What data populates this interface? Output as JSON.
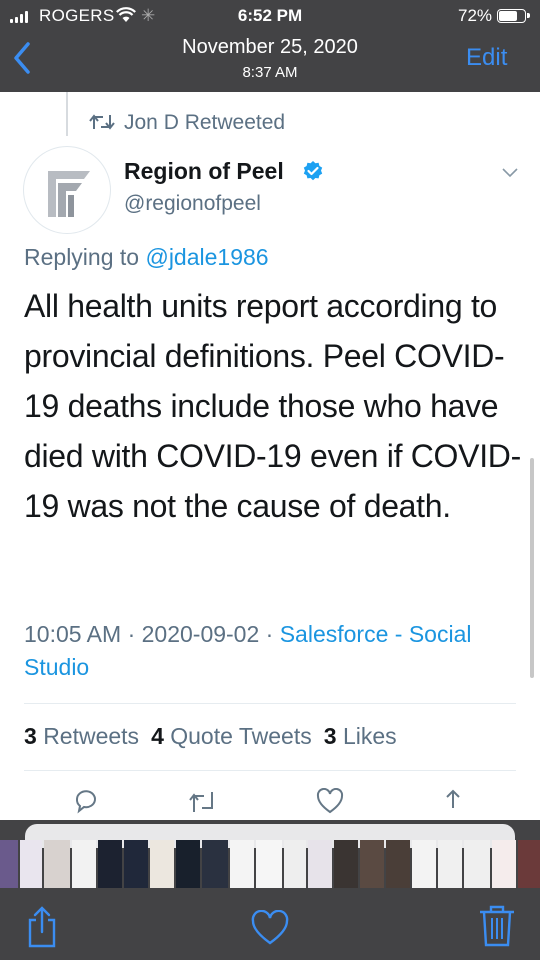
{
  "status_bar": {
    "carrier": "ROGERS",
    "time": "6:52 PM",
    "battery": "72%"
  },
  "nav": {
    "date": "November 25, 2020",
    "time": "8:37 AM",
    "edit_label": "Edit"
  },
  "tweet": {
    "retweeted_by": "Jon D Retweeted",
    "author_name": "Region of Peel",
    "handle": "@regionofpeel",
    "replying_prefix": "Replying to ",
    "replying_to": "@jdale1986",
    "body": "All health units report according to provincial definitions. Peel COVID-19 deaths include those who have died with COVID-19 even if COVID-19 was not the cause of death.",
    "timestamp": "10:05 AM · 2020-09-02 · ",
    "source": "Salesforce - Social Studio",
    "stats": {
      "retweets_count": "3",
      "retweets_label": "Retweets",
      "quotes_count": "4",
      "quotes_label": "Quote Tweets",
      "likes_count": "3",
      "likes_label": "Likes"
    }
  },
  "icons": {
    "back": "chevron-left-icon",
    "share": "share-icon",
    "favorite": "heart-icon",
    "delete": "trash-icon"
  },
  "colors": {
    "accent": "#3b8df1",
    "twitter_blue": "#1b95e0",
    "chrome": "#434345"
  },
  "thumbnails": [
    {
      "color": "#6a5a8c"
    },
    {
      "color": "#e9e5ee"
    },
    {
      "color": "#d8d2cf"
    },
    {
      "color": "#f2f2f2"
    },
    {
      "color": "#1c2230"
    },
    {
      "color": "#20283a"
    },
    {
      "color": "#ece7df"
    },
    {
      "color": "#18202c"
    },
    {
      "color": "#2a3140"
    },
    {
      "color": "#f4f4f4"
    },
    {
      "color": "#f6f6f6"
    },
    {
      "color": "#eeeeee"
    },
    {
      "color": "#e7e3ea"
    },
    {
      "color": "#3a3432"
    },
    {
      "color": "#5a4a42"
    },
    {
      "color": "#4a3e38"
    },
    {
      "color": "#f3f3f3"
    },
    {
      "color": "#f0f0f0"
    },
    {
      "color": "#efefef"
    },
    {
      "color": "#f5ecec"
    },
    {
      "color": "#6b3a3a"
    }
  ]
}
